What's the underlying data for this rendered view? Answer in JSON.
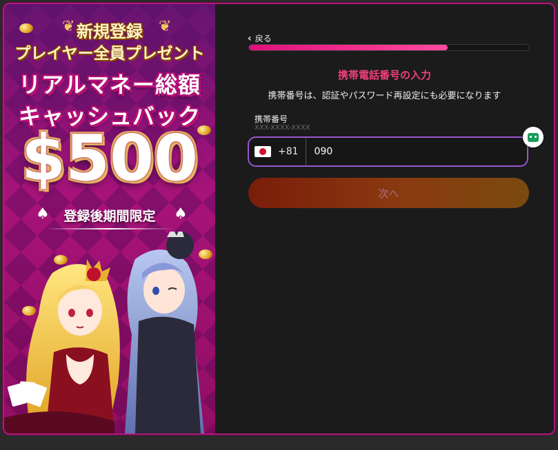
{
  "promo": {
    "heading1": "新規登録",
    "heading2": "プレイヤー全員プレゼント",
    "headline1": "リアルマネー総額",
    "headline2": "キャッシュバック",
    "amount": "$500",
    "limited": "登録後期間限定"
  },
  "form": {
    "back_label": "戻る",
    "progress": 0.71,
    "title": "携帯電話番号の入力",
    "subtitle": "携帯番号は、認証やパスワード再設定にも必要になります",
    "phone_label": "携帯番号",
    "phone_hint": "XXX-XXXX-XXXX",
    "country_code": "+81",
    "phone_value": "090",
    "next_label": "次へ"
  },
  "colors": {
    "accent": "#e0107a",
    "title": "#f0407a",
    "input_border": "#9a56d0",
    "button": "#7a2a0e"
  },
  "icons": {
    "back": "chevron-left-icon",
    "flag": "japan-flag-icon",
    "side_badge": "chat-bot-icon"
  }
}
